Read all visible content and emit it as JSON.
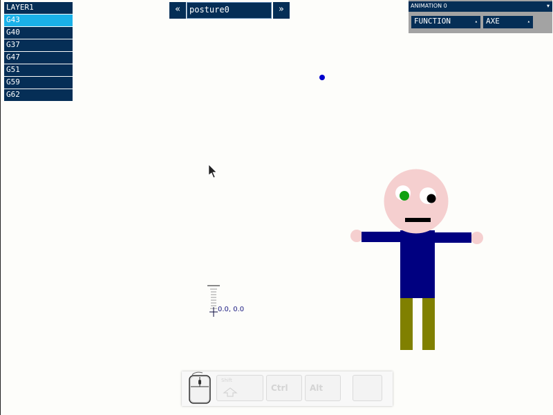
{
  "layers": [
    {
      "label": "LAYER1",
      "selected": false
    },
    {
      "label": "G43",
      "selected": true
    },
    {
      "label": "G40",
      "selected": false
    },
    {
      "label": "G37",
      "selected": false
    },
    {
      "label": "G47",
      "selected": false
    },
    {
      "label": "G51",
      "selected": false
    },
    {
      "label": "G59",
      "selected": false
    },
    {
      "label": "G62",
      "selected": false
    }
  ],
  "posture_nav": {
    "prev_label": "«",
    "next_label": "»",
    "value": "posture0"
  },
  "animation_panel": {
    "animation_select": "ANIMATION 0",
    "function_select": "FUNCTION",
    "axe_select": "AXE",
    "dropdown_arrow": "▾",
    "up_arrow": "▴"
  },
  "coordinate_readout": "0.0, 0.0",
  "keys": {
    "shift": "Shift",
    "ctrl": "Ctrl",
    "alt": "Alt"
  },
  "colors": {
    "panel": "#052e56",
    "selected": "#1ab1e8",
    "skin": "#f5cfcf",
    "shirt": "#000080",
    "pants": "#808000",
    "left_eye": "#10a010",
    "dot": "#0000cc"
  }
}
